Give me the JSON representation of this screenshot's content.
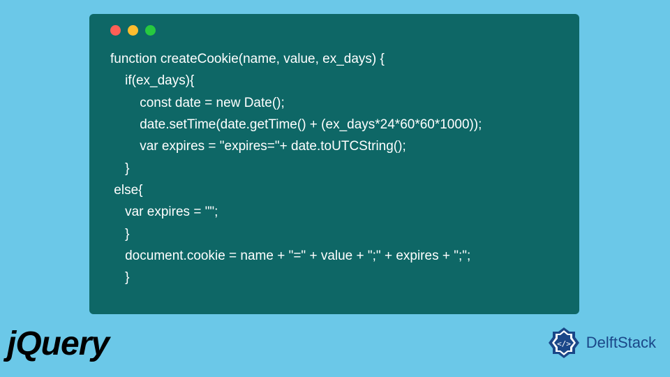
{
  "code": {
    "lines": [
      "function createCookie(name, value, ex_days) {",
      "    if(ex_days){",
      "        const date = new Date();",
      "        date.setTime(date.getTime() + (ex_days*24*60*60*1000));",
      "        var expires = \"expires=\"+ date.toUTCString();",
      "    }",
      " else{",
      "    var expires = \"\";",
      "    }",
      "    document.cookie = name + \"=\" + value + \";\" + expires + \";\";",
      "    }"
    ]
  },
  "logos": {
    "jquery": "jQuery",
    "delftstack": "DelftStack"
  }
}
